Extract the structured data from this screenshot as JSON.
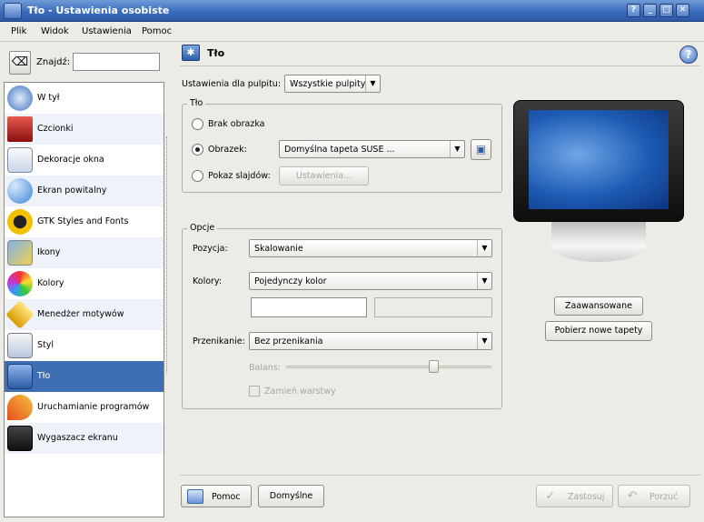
{
  "window": {
    "title": "Tło - Ustawienia osobiste"
  },
  "menubar": [
    "Plik",
    "Widok",
    "Ustawienia",
    "Pomoc"
  ],
  "search": {
    "label": "Znajdź:",
    "value": ""
  },
  "sidebar": {
    "items": [
      {
        "label": "W tył",
        "icon": "back-arrow-icon"
      },
      {
        "label": "Czcionki",
        "icon": "fonts-icon"
      },
      {
        "label": "Dekoracje okna",
        "icon": "window-decoration-icon"
      },
      {
        "label": "Ekran powitalny",
        "icon": "splash-screen-icon"
      },
      {
        "label": "GTK Styles and Fonts",
        "icon": "gtk-icon"
      },
      {
        "label": "Ikony",
        "icon": "icons-icon"
      },
      {
        "label": "Kolory",
        "icon": "colors-icon"
      },
      {
        "label": "Menedżer motywów",
        "icon": "theme-manager-icon"
      },
      {
        "label": "Styl",
        "icon": "style-icon"
      },
      {
        "label": "Tło",
        "icon": "background-icon",
        "selected": true
      },
      {
        "label": "Uruchamianie programów",
        "icon": "launch-feedback-icon"
      },
      {
        "label": "Wygaszacz ekranu",
        "icon": "screensaver-icon"
      }
    ]
  },
  "header": {
    "title": "Tło"
  },
  "desktop_setting": {
    "label": "Ustawienia dla pulpitu:",
    "value": "Wszystkie pulpity"
  },
  "background_group": {
    "title": "Tło",
    "no_picture": "Brak obrazka",
    "picture": "Obrazek:",
    "picture_value": "Domyślna tapeta SUSE ...",
    "slideshow": "Pokaz slajdów:",
    "slideshow_settings": "Ustawienia..."
  },
  "options_group": {
    "title": "Opcje",
    "position_label": "Pozycja:",
    "position_value": "Skalowanie",
    "colors_label": "Kolory:",
    "colors_value": "Pojedynczy kolor",
    "blending_label": "Przenikanie:",
    "blending_value": "Bez przenikania",
    "balance_label": "Balans:",
    "reverse_roles": "Zamień warstwy",
    "balance_value": 0.72
  },
  "buttons": {
    "advanced": "Zaawansowane",
    "get_new": "Pobierz nowe tapety",
    "help": "Pomoc",
    "defaults": "Domyślne",
    "apply": "Zastosuj",
    "reset": "Porzuć"
  },
  "colors": {
    "selection": "#3f6fb3",
    "titlebar": "#3a6cbd"
  }
}
